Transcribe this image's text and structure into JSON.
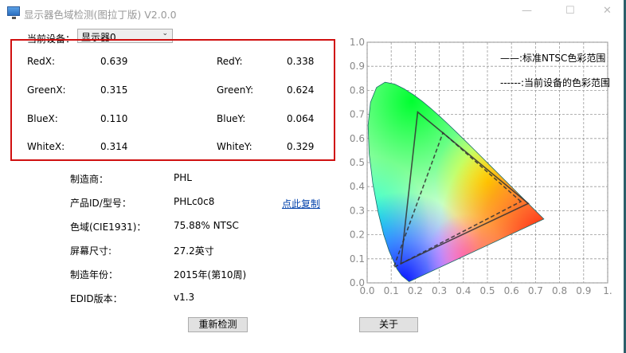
{
  "window": {
    "title": "显示器色域检测(图拉丁版) V2.0.0"
  },
  "device": {
    "label": "当前设备：",
    "selected": "显示器0"
  },
  "coords": [
    {
      "lx": "RedX:",
      "vx": "0.639",
      "ly": "RedY:",
      "vy": "0.338"
    },
    {
      "lx": "GreenX:",
      "vx": "0.315",
      "ly": "GreenY:",
      "vy": "0.624"
    },
    {
      "lx": "BlueX:",
      "vx": "0.110",
      "ly": "BlueY:",
      "vy": "0.064"
    },
    {
      "lx": "WhiteX:",
      "vx": "0.314",
      "ly": "WhiteY:",
      "vy": "0.329"
    }
  ],
  "info": [
    {
      "label": "制造商：",
      "value": "PHL"
    },
    {
      "label": "产品ID/型号：",
      "value": "PHLc0c8"
    },
    {
      "label": "色域(CIE1931)：",
      "value": "75.88% NTSC"
    },
    {
      "label": "屏幕尺寸:",
      "value": "27.2英寸"
    },
    {
      "label": "制造年份：",
      "value": "2015年(第10周)"
    },
    {
      "label": "EDID版本：",
      "value": "v1.3"
    }
  ],
  "copy_link": "点此复制",
  "buttons": {
    "redetect": "重新检测",
    "about": "关于"
  },
  "chart_data": {
    "type": "scatter",
    "title": "CIE1931",
    "xlim": [
      0,
      1
    ],
    "ylim": [
      0,
      1
    ],
    "grid": true,
    "xticks": [
      "0.0",
      "0.1",
      "0.2",
      "0.3",
      "0.4",
      "0.5",
      "0.6",
      "0.7",
      "0.8",
      "0.9",
      "1."
    ],
    "yticks": [
      "0.0",
      "0.1",
      "0.2",
      "0.3",
      "0.4",
      "0.5",
      "0.6",
      "0.7",
      "0.8",
      "0.9",
      "1.0"
    ],
    "legend": [
      "——:标准NTSC色彩范围",
      "------:当前设备的色彩范围"
    ],
    "legend_position": "top-right",
    "ntsc": [
      [
        0.67,
        0.33
      ],
      [
        0.21,
        0.71
      ],
      [
        0.14,
        0.08
      ]
    ],
    "device": [
      [
        0.639,
        0.338
      ],
      [
        0.315,
        0.624
      ],
      [
        0.11,
        0.064
      ]
    ],
    "locus": [
      [
        0.1741,
        0.005
      ],
      [
        0.144,
        0.0297
      ],
      [
        0.1241,
        0.0578
      ],
      [
        0.0913,
        0.1327
      ],
      [
        0.0687,
        0.2007
      ],
      [
        0.0454,
        0.295
      ],
      [
        0.0235,
        0.4127
      ],
      [
        0.0082,
        0.5384
      ],
      [
        0.0039,
        0.6548
      ],
      [
        0.0139,
        0.7502
      ],
      [
        0.0389,
        0.812
      ],
      [
        0.0743,
        0.8338
      ],
      [
        0.1142,
        0.8262
      ],
      [
        0.1547,
        0.8059
      ],
      [
        0.1929,
        0.7816
      ],
      [
        0.2296,
        0.7543
      ],
      [
        0.2658,
        0.7243
      ],
      [
        0.3016,
        0.6923
      ],
      [
        0.3373,
        0.6589
      ],
      [
        0.3731,
        0.6245
      ],
      [
        0.4087,
        0.5896
      ],
      [
        0.4441,
        0.5547
      ],
      [
        0.4788,
        0.5202
      ],
      [
        0.5125,
        0.4866
      ],
      [
        0.5448,
        0.4544
      ],
      [
        0.5752,
        0.4242
      ],
      [
        0.6029,
        0.3965
      ],
      [
        0.627,
        0.3725
      ],
      [
        0.6482,
        0.3514
      ],
      [
        0.6658,
        0.334
      ],
      [
        0.6915,
        0.3083
      ],
      [
        0.7347,
        0.2653
      ]
    ]
  }
}
